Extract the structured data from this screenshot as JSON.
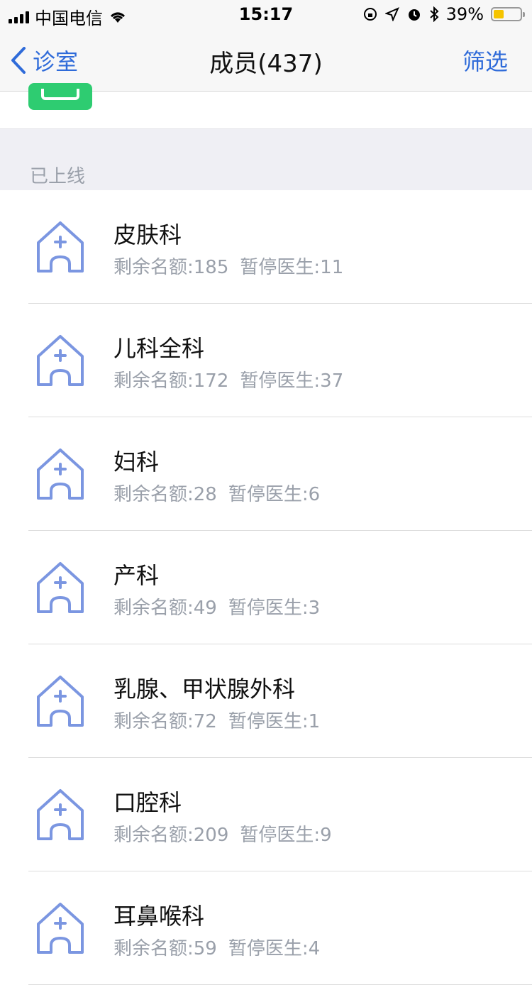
{
  "status_bar": {
    "carrier": "中国电信",
    "time": "15:17",
    "battery": "39%",
    "battery_level": 0.39
  },
  "nav": {
    "back_label": "诊室",
    "title": "成员(437)",
    "filter_label": "筛选"
  },
  "section": {
    "title": "已上线"
  },
  "colors": {
    "accent_blue": "#2f6bd9",
    "icon_blue": "#7b96e1",
    "green": "#2ecc71",
    "muted_text": "#9aa0aa"
  },
  "icons": {
    "list_icon": "clinic-house-plus-icon"
  },
  "departments": [
    {
      "name": "皮肤科",
      "remaining": "剩余名额:185",
      "paused": "暂停医生:11"
    },
    {
      "name": "儿科全科",
      "remaining": "剩余名额:172",
      "paused": "暂停医生:37"
    },
    {
      "name": "妇科",
      "remaining": "剩余名额:28",
      "paused": "暂停医生:6"
    },
    {
      "name": "产科",
      "remaining": "剩余名额:49",
      "paused": "暂停医生:3"
    },
    {
      "name": "乳腺、甲状腺外科",
      "remaining": "剩余名额:72",
      "paused": "暂停医生:1"
    },
    {
      "name": "口腔科",
      "remaining": "剩余名额:209",
      "paused": "暂停医生:9"
    },
    {
      "name": "耳鼻喉科",
      "remaining": "剩余名额:59",
      "paused": "暂停医生:4"
    }
  ]
}
